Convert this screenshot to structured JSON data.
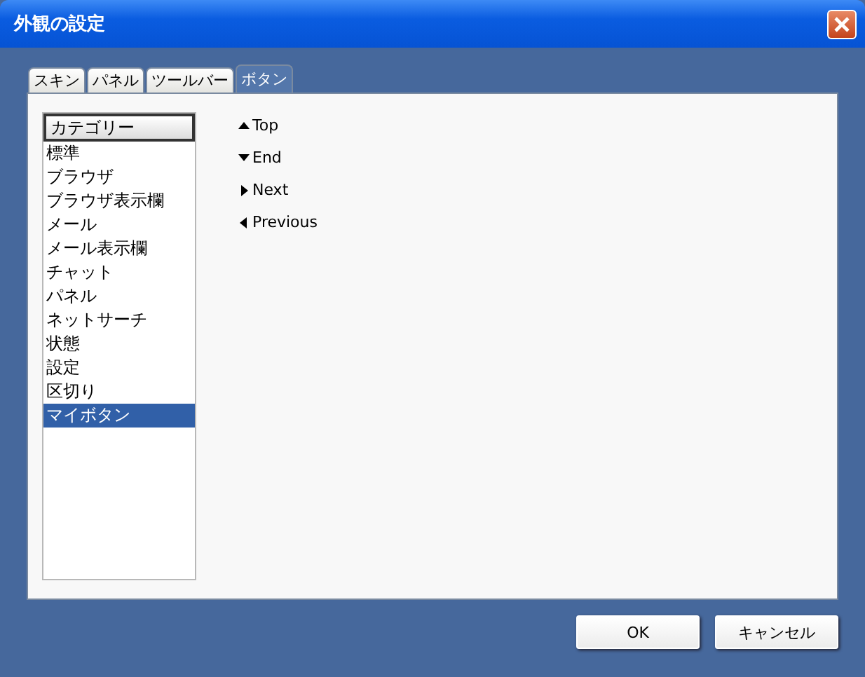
{
  "window": {
    "title": "外観の設定"
  },
  "tabs": [
    {
      "label": "スキン",
      "selected": false
    },
    {
      "label": "パネル",
      "selected": false
    },
    {
      "label": "ツールバー",
      "selected": false
    },
    {
      "label": "ボタン",
      "selected": true
    }
  ],
  "category_list": {
    "header": "カテゴリー",
    "items": [
      {
        "label": "標準",
        "selected": false
      },
      {
        "label": "ブラウザ",
        "selected": false
      },
      {
        "label": "ブラウザ表示欄",
        "selected": false
      },
      {
        "label": "メール",
        "selected": false
      },
      {
        "label": "メール表示欄",
        "selected": false
      },
      {
        "label": "チャット",
        "selected": false
      },
      {
        "label": "パネル",
        "selected": false
      },
      {
        "label": "ネットサーチ",
        "selected": false
      },
      {
        "label": "状態",
        "selected": false
      },
      {
        "label": "設定",
        "selected": false
      },
      {
        "label": "区切り",
        "selected": false
      },
      {
        "label": "マイボタン",
        "selected": true
      }
    ]
  },
  "buttons_list": [
    {
      "label": "Top",
      "kind": "up"
    },
    {
      "label": "End",
      "kind": "down"
    },
    {
      "label": "Next",
      "kind": "right"
    },
    {
      "label": "Previous",
      "kind": "left"
    }
  ],
  "dialog_buttons": [
    "OK",
    "キャンセル"
  ]
}
